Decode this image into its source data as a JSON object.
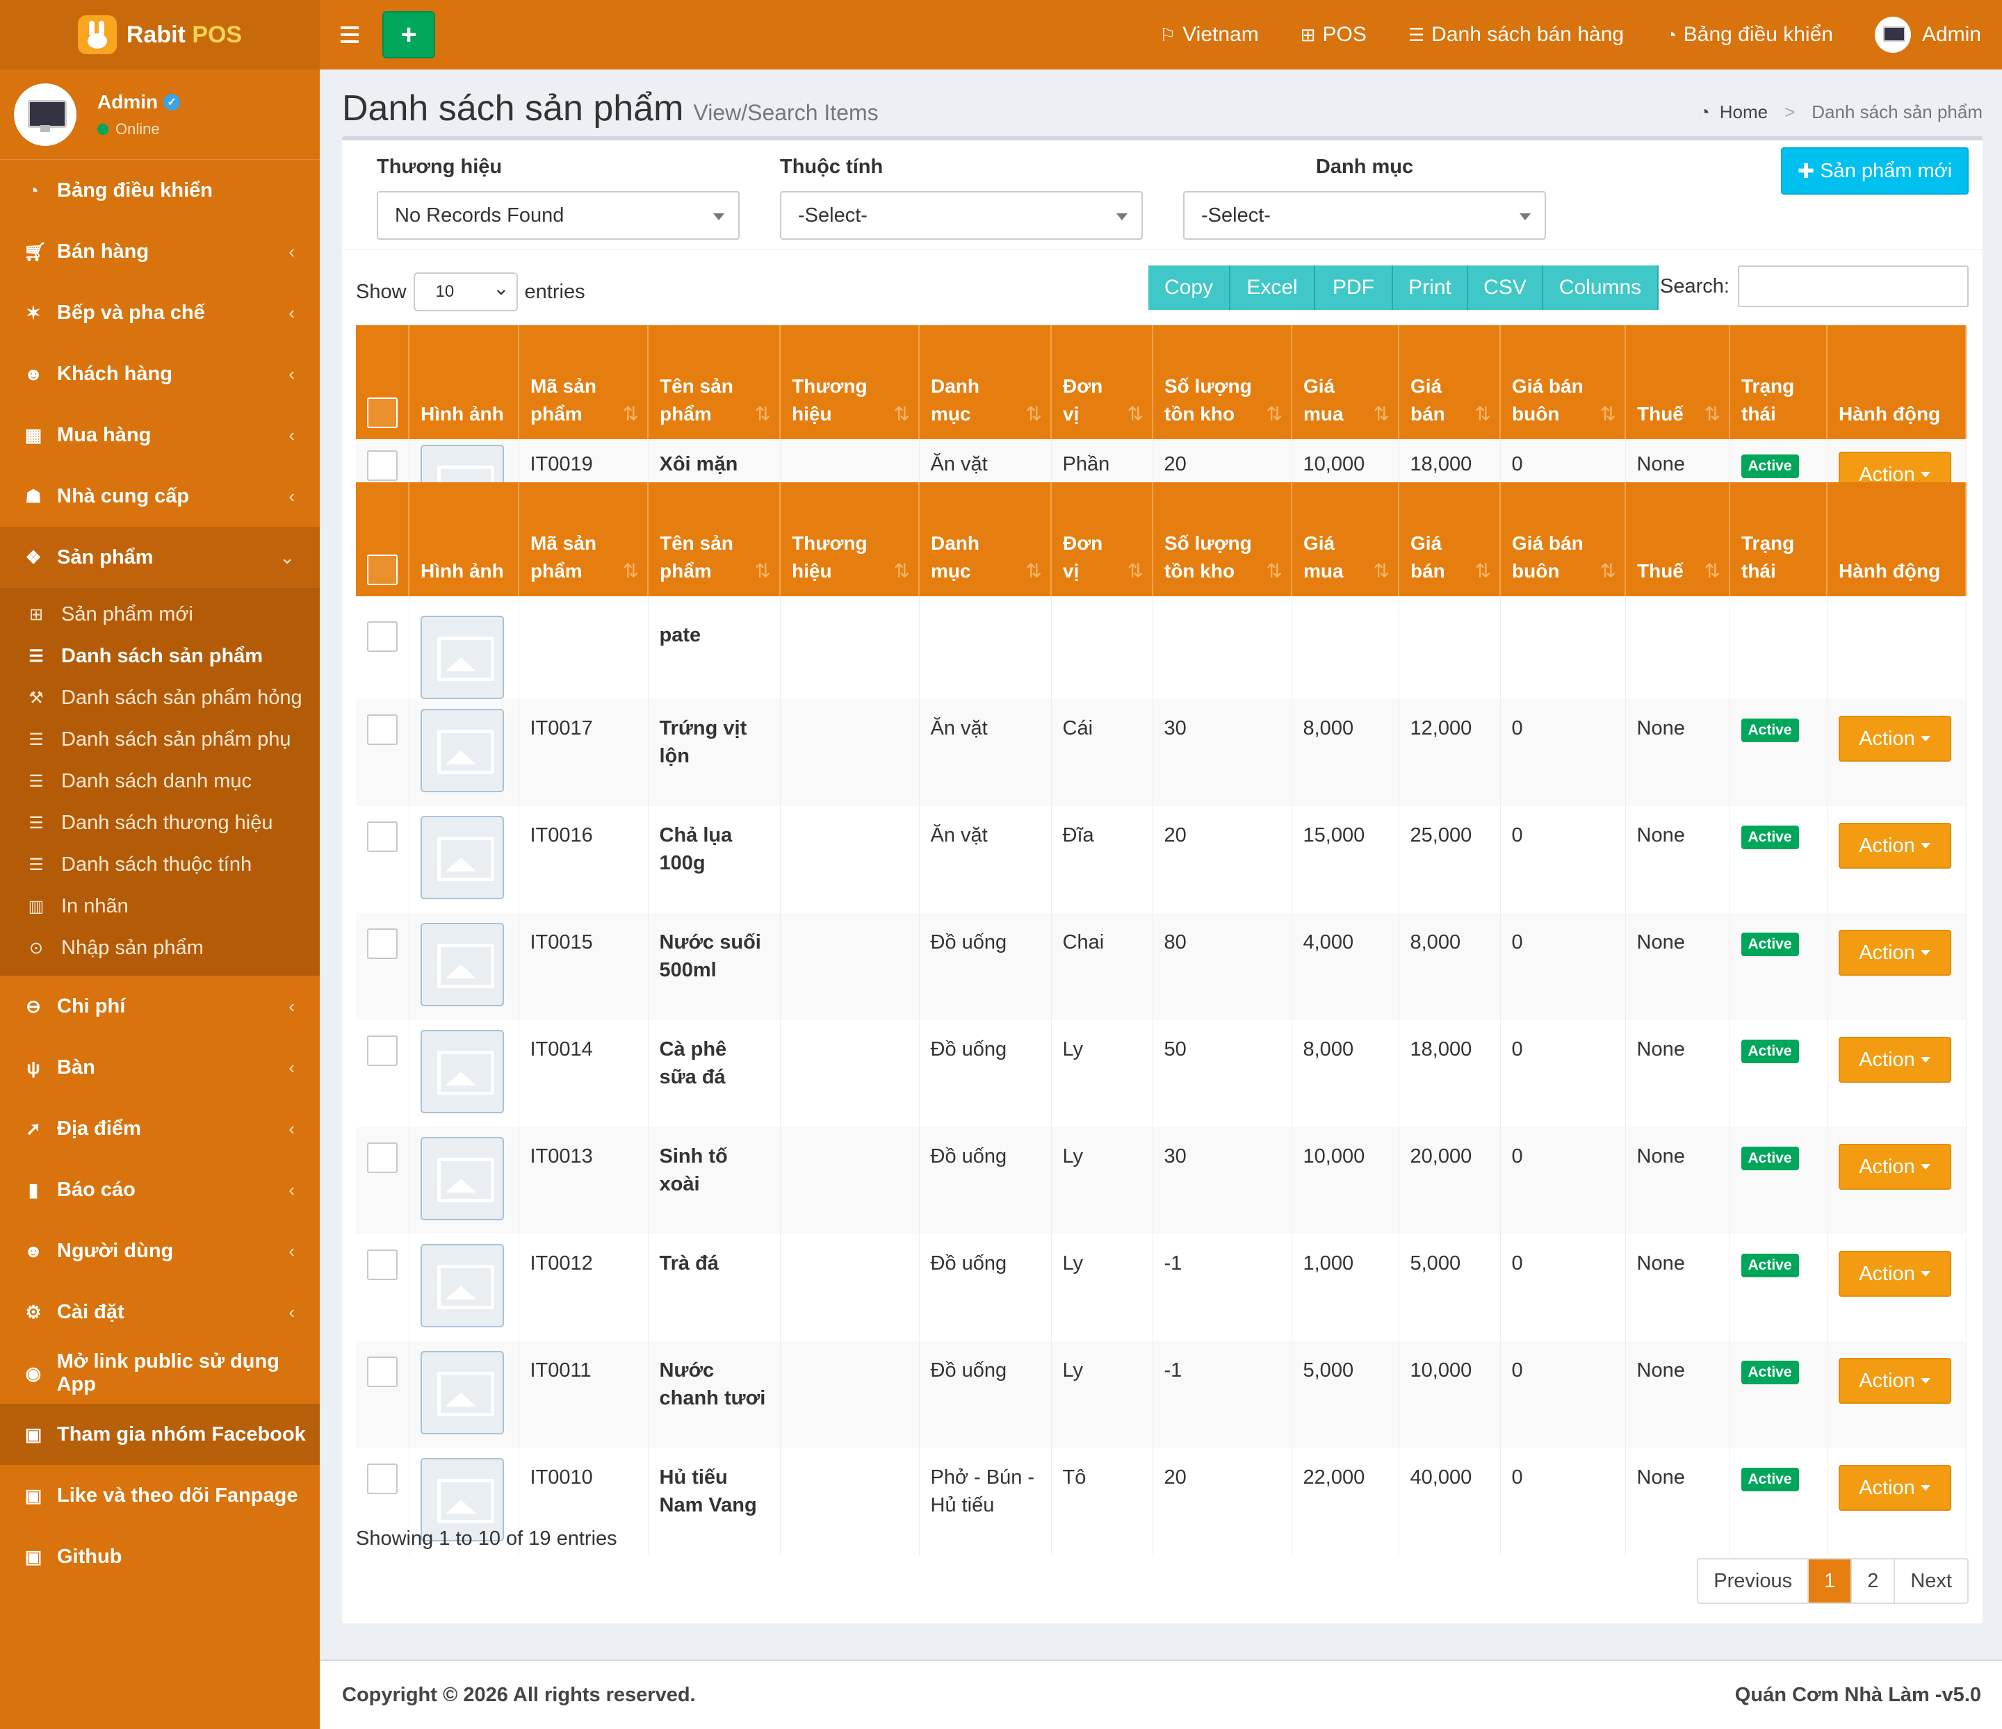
{
  "brand": {
    "name": "Rabit",
    "suffix": "POS"
  },
  "user": {
    "name": "Admin",
    "status": "Online"
  },
  "sidebar": {
    "items": [
      {
        "label": "Bảng điều khiển",
        "icon": "dashboard-icon"
      },
      {
        "label": "Bán hàng",
        "icon": "cart-icon"
      },
      {
        "label": "Bếp và pha chế",
        "icon": "kitchen-icon"
      },
      {
        "label": "Khách hàng",
        "icon": "users-icon"
      },
      {
        "label": "Mua hàng",
        "icon": "grid-icon"
      },
      {
        "label": "Nhà cung cấp",
        "icon": "supplier-icon"
      },
      {
        "label": "Sản phẩm",
        "icon": "cubes-icon"
      },
      {
        "label": "Chi phí",
        "icon": "minus-circle-icon"
      },
      {
        "label": "Bàn",
        "icon": "cutlery-icon"
      },
      {
        "label": "Địa điểm",
        "icon": "location-icon"
      },
      {
        "label": "Báo cáo",
        "icon": "bar-chart-icon"
      },
      {
        "label": "Người dùng",
        "icon": "users-icon"
      },
      {
        "label": "Cài đặt",
        "icon": "gears-icon"
      },
      {
        "label": "Mở link public sử dụng App",
        "icon": "globe-icon"
      },
      {
        "label": "Tham gia nhóm Facebook",
        "icon": "briefcase-icon"
      },
      {
        "label": "Like và theo dõi Fanpage",
        "icon": "briefcase-icon"
      },
      {
        "label": "Github",
        "icon": "briefcase-icon"
      }
    ],
    "submenu": [
      {
        "label": "Sản phẩm mới",
        "icon": "plus-square-icon"
      },
      {
        "label": "Danh sách sản phẩm",
        "icon": "list-icon"
      },
      {
        "label": "Danh sách sản phẩm hỏng",
        "icon": "wrench-icon"
      },
      {
        "label": "Danh sách sản phẩm phụ",
        "icon": "list-icon"
      },
      {
        "label": "Danh sách danh mục",
        "icon": "list-icon"
      },
      {
        "label": "Danh sách thương hiệu",
        "icon": "list-icon"
      },
      {
        "label": "Danh sách thuộc tính",
        "icon": "list-icon"
      },
      {
        "label": "In nhãn",
        "icon": "barcode-icon"
      },
      {
        "label": "Nhập sản phẩm",
        "icon": "arrow-circle-icon"
      }
    ]
  },
  "topbar": {
    "nav": [
      "Vietnam",
      "POS",
      "Danh sách bán hàng",
      "Bảng điều khiển",
      "Admin"
    ]
  },
  "header": {
    "title": "Danh sách sản phẩm",
    "subtitle": "View/Search Items",
    "breadcrumb": [
      "Home",
      "Danh sách sản phẩm"
    ]
  },
  "filters": {
    "brand": {
      "label": "Thương hiệu",
      "value": "No Records Found"
    },
    "attribute": {
      "label": "Thuộc tính",
      "value": "-Select-"
    },
    "category": {
      "label": "Danh mục",
      "value": "-Select-"
    },
    "new_button": "Sản phẩm mới"
  },
  "table_tools": {
    "show": "Show",
    "length": "10",
    "entries": "entries",
    "buttons": [
      "Copy",
      "Excel",
      "PDF",
      "Print",
      "CSV",
      "Columns"
    ],
    "search_label": "Search:"
  },
  "columns": [
    {
      "l1": "",
      "l2": "Hình ảnh",
      "sort": false
    },
    {
      "l1": "Mã sản",
      "l2": "phẩm",
      "sort": true
    },
    {
      "l1": "Tên sản",
      "l2": "phẩm",
      "sort": true
    },
    {
      "l1": "Thương",
      "l2": "hiệu",
      "sort": true
    },
    {
      "l1": "Danh",
      "l2": "mục",
      "sort": true
    },
    {
      "l1": "Đơn",
      "l2": "vị",
      "sort": true
    },
    {
      "l1": "Số lượng",
      "l2": "tồn kho",
      "sort": true
    },
    {
      "l1": "Giá",
      "l2": "mua",
      "sort": true
    },
    {
      "l1": "Giá",
      "l2": "bán",
      "sort": true
    },
    {
      "l1": "Giá bán",
      "l2": "buôn",
      "sort": true
    },
    {
      "l1": "",
      "l2": "Thuế",
      "sort": true
    },
    {
      "l1": "Trạng",
      "l2": "thái",
      "sort": false
    },
    {
      "l1": "",
      "l2": "Hành động",
      "sort": false
    }
  ],
  "rows": [
    {
      "code": "IT0019",
      "name": "Xôi mặn",
      "brand": "",
      "category": "Ăn vặt",
      "unit": "Phần",
      "stock": "20",
      "cost": "10,000",
      "price": "18,000",
      "wholesale": "0",
      "tax": "None",
      "status": "Active",
      "action": "Action"
    },
    {
      "code": "",
      "name": "pate",
      "brand": "",
      "category": "",
      "unit": "",
      "stock": "",
      "cost": "",
      "price": "",
      "wholesale": "",
      "tax": "",
      "status": "",
      "action": ""
    },
    {
      "code": "IT0017",
      "name": "Trứng vịt lộn",
      "brand": "",
      "category": "Ăn vặt",
      "unit": "Cái",
      "stock": "30",
      "cost": "8,000",
      "price": "12,000",
      "wholesale": "0",
      "tax": "None",
      "status": "Active",
      "action": "Action"
    },
    {
      "code": "IT0016",
      "name": "Chả lụa 100g",
      "brand": "",
      "category": "Ăn vặt",
      "unit": "Đĩa",
      "stock": "20",
      "cost": "15,000",
      "price": "25,000",
      "wholesale": "0",
      "tax": "None",
      "status": "Active",
      "action": "Action"
    },
    {
      "code": "IT0015",
      "name": "Nước suối 500ml",
      "brand": "",
      "category": "Đồ uống",
      "unit": "Chai",
      "stock": "80",
      "cost": "4,000",
      "price": "8,000",
      "wholesale": "0",
      "tax": "None",
      "status": "Active",
      "action": "Action"
    },
    {
      "code": "IT0014",
      "name": "Cà phê sữa đá",
      "brand": "",
      "category": "Đồ uống",
      "unit": "Ly",
      "stock": "50",
      "cost": "8,000",
      "price": "18,000",
      "wholesale": "0",
      "tax": "None",
      "status": "Active",
      "action": "Action"
    },
    {
      "code": "IT0013",
      "name": "Sinh tố xoài",
      "brand": "",
      "category": "Đồ uống",
      "unit": "Ly",
      "stock": "30",
      "cost": "10,000",
      "price": "20,000",
      "wholesale": "0",
      "tax": "None",
      "status": "Active",
      "action": "Action"
    },
    {
      "code": "IT0012",
      "name": "Trà đá",
      "brand": "",
      "category": "Đồ uống",
      "unit": "Ly",
      "stock": "-1",
      "cost": "1,000",
      "price": "5,000",
      "wholesale": "0",
      "tax": "None",
      "status": "Active",
      "action": "Action"
    },
    {
      "code": "IT0011",
      "name": "Nước chanh tươi",
      "brand": "",
      "category": "Đồ uống",
      "unit": "Ly",
      "stock": "-1",
      "cost": "5,000",
      "price": "10,000",
      "wholesale": "0",
      "tax": "None",
      "status": "Active",
      "action": "Action"
    },
    {
      "code": "IT0010",
      "name": "Hủ tiếu Nam Vang",
      "brand": "",
      "category": "Phở - Bún - Hủ tiếu",
      "unit": "Tô",
      "stock": "20",
      "cost": "22,000",
      "price": "40,000",
      "wholesale": "0",
      "tax": "None",
      "status": "Active",
      "action": "Action"
    }
  ],
  "table_info": "Showing 1 to 10 of 19 entries",
  "pagination": [
    "Previous",
    "1",
    "2",
    "Next"
  ],
  "footer": {
    "copyright": "Copyright © 2026 All rights reserved.",
    "version": "Quán Cơm Nhà Làm -v5.0"
  },
  "colors": {
    "primary": "#d9730d",
    "header": "#e67e0f",
    "success": "#00a65a",
    "info": "#00c0ef",
    "warning": "#f39c12",
    "dt_button": "#3fc8c7"
  }
}
